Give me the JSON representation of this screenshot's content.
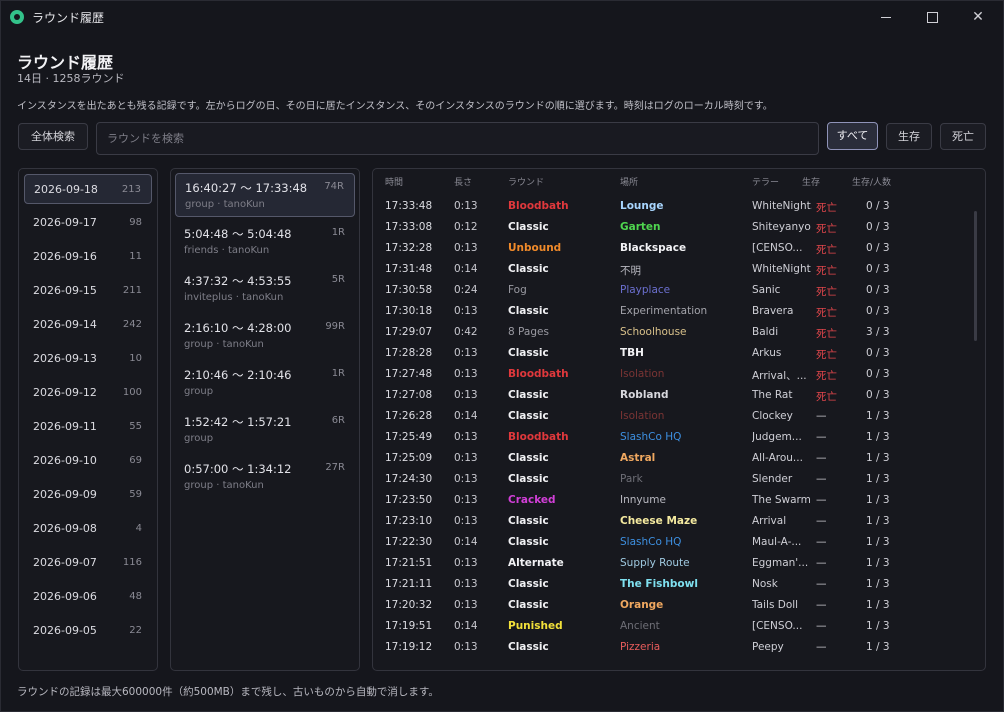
{
  "window": {
    "title": "ラウンド履歴"
  },
  "header": {
    "title": "ラウンド履歴",
    "subtitle": "14日 · 1258ラウンド",
    "description": "インスタンスを出たあとも残る記録です。左からログの日、その日に居たインスタンス、そのインスタンスのラウンドの順に選びます。時刻はログのローカル時刻です。"
  },
  "toolbar": {
    "all_search_label": "全体検索",
    "search_placeholder": "ラウンドを検索",
    "filter_all": "すべて",
    "filter_alive": "生存",
    "filter_dead": "死亡",
    "selected_filter": "すべて"
  },
  "dates": [
    {
      "date": "2026-09-18",
      "count": "213",
      "selected": true
    },
    {
      "date": "2026-09-17",
      "count": "98"
    },
    {
      "date": "2026-09-16",
      "count": "11"
    },
    {
      "date": "2026-09-15",
      "count": "211"
    },
    {
      "date": "2026-09-14",
      "count": "242"
    },
    {
      "date": "2026-09-13",
      "count": "10"
    },
    {
      "date": "2026-09-12",
      "count": "100"
    },
    {
      "date": "2026-09-11",
      "count": "55"
    },
    {
      "date": "2026-09-10",
      "count": "69"
    },
    {
      "date": "2026-09-09",
      "count": "59"
    },
    {
      "date": "2026-09-08",
      "count": "4"
    },
    {
      "date": "2026-09-07",
      "count": "116"
    },
    {
      "date": "2026-09-06",
      "count": "48"
    },
    {
      "date": "2026-09-05",
      "count": "22"
    }
  ],
  "instances": [
    {
      "time": "16:40:27 〜 17:33:48",
      "rounds": "74R",
      "meta": "group · tanoKun",
      "selected": true
    },
    {
      "time": "5:04:48 〜 5:04:48",
      "rounds": "1R",
      "meta": "friends · tanoKun"
    },
    {
      "time": "4:37:32 〜 4:53:55",
      "rounds": "5R",
      "meta": "inviteplus · tanoKun"
    },
    {
      "time": "2:16:10 〜 4:28:00",
      "rounds": "99R",
      "meta": "group · tanoKun"
    },
    {
      "time": "2:10:46 〜 2:10:46",
      "rounds": "1R",
      "meta": "group"
    },
    {
      "time": "1:52:42 〜 1:57:21",
      "rounds": "6R",
      "meta": "group"
    },
    {
      "time": "0:57:00 〜 1:34:12",
      "rounds": "27R",
      "meta": "group · tanoKun"
    }
  ],
  "table": {
    "headers": {
      "time": "時間",
      "length": "長さ",
      "round": "ラウンド",
      "place": "場所",
      "terror": "テラー",
      "status": "生存",
      "ratio": "生存/人数"
    },
    "rows": [
      {
        "time": "17:33:48",
        "length": "0:13",
        "round": "Bloodbath",
        "round_color": "#e0383c",
        "place": "Lounge",
        "place_color": "#a9d6ff",
        "place_bold": true,
        "terror": "WhiteNight...",
        "status": "死亡",
        "dead": true,
        "ratio": "0 / 3"
      },
      {
        "time": "17:33:08",
        "length": "0:12",
        "round": "Classic",
        "round_color": "#f2f2f5",
        "place": "Garten",
        "place_color": "#4fd64f",
        "place_bold": true,
        "terror": "Shiteyanyo",
        "status": "死亡",
        "dead": true,
        "ratio": "0 / 3"
      },
      {
        "time": "17:32:28",
        "length": "0:13",
        "round": "Unbound",
        "round_color": "#f08a2a",
        "place": "Blackspace",
        "place_color": "#f2f2f5",
        "place_bold": true,
        "terror": "[CENSO...",
        "status": "死亡",
        "dead": true,
        "ratio": "0 / 3"
      },
      {
        "time": "17:31:48",
        "length": "0:14",
        "round": "Classic",
        "round_color": "#f2f2f5",
        "place": "不明",
        "place_color": "#b8b8c0",
        "place_bold": false,
        "terror": "WhiteNight",
        "status": "死亡",
        "dead": true,
        "ratio": "0 / 3"
      },
      {
        "time": "17:30:58",
        "length": "0:24",
        "round": "Fog",
        "round_color": "#9a9aa2",
        "round_bold": false,
        "place": "Playplace",
        "place_color": "#6b6fcf",
        "place_bold": false,
        "terror": "Sanic",
        "status": "死亡",
        "dead": true,
        "ratio": "0 / 3"
      },
      {
        "time": "17:30:18",
        "length": "0:13",
        "round": "Classic",
        "round_color": "#f2f2f5",
        "place": "Experimentation",
        "place_color": "#a3a3aa",
        "place_bold": false,
        "terror": "Bravera",
        "status": "死亡",
        "dead": true,
        "ratio": "0 / 3"
      },
      {
        "time": "17:29:07",
        "length": "0:42",
        "round": "8 Pages",
        "round_color": "#9a9aa2",
        "round_bold": false,
        "place": "Schoolhouse",
        "place_color": "#d8c08a",
        "place_bold": false,
        "terror": "Baldi",
        "status": "死亡",
        "dead": true,
        "ratio": "3 / 3"
      },
      {
        "time": "17:28:28",
        "length": "0:13",
        "round": "Classic",
        "round_color": "#f2f2f5",
        "place": "TBH",
        "place_color": "#f2f2f5",
        "place_bold": true,
        "terror": "Arkus",
        "status": "死亡",
        "dead": true,
        "ratio": "0 / 3"
      },
      {
        "time": "17:27:48",
        "length": "0:13",
        "round": "Bloodbath",
        "round_color": "#e0383c",
        "place": "Isolation",
        "place_color": "#7a3434",
        "place_bold": false,
        "terror": "Arrival、...",
        "status": "死亡",
        "dead": true,
        "ratio": "0 / 3"
      },
      {
        "time": "17:27:08",
        "length": "0:13",
        "round": "Classic",
        "round_color": "#f2f2f5",
        "place": "Robland",
        "place_color": "#d8d8de",
        "place_bold": true,
        "terror": "The Rat",
        "status": "死亡",
        "dead": true,
        "ratio": "0 / 3"
      },
      {
        "time": "17:26:28",
        "length": "0:14",
        "round": "Classic",
        "round_color": "#f2f2f5",
        "place": "Isolation",
        "place_color": "#7a3434",
        "place_bold": false,
        "terror": "Clockey",
        "status": "—",
        "dead": false,
        "ratio": "1 / 3"
      },
      {
        "time": "17:25:49",
        "length": "0:13",
        "round": "Bloodbath",
        "round_color": "#e0383c",
        "place": "SlashCo HQ",
        "place_color": "#3d8fe0",
        "place_bold": false,
        "terror": "Judgem...",
        "status": "—",
        "dead": false,
        "ratio": "1 / 3"
      },
      {
        "time": "17:25:09",
        "length": "0:13",
        "round": "Classic",
        "round_color": "#f2f2f5",
        "place": "Astral",
        "place_color": "#f0a860",
        "place_bold": true,
        "terror": "All-Arou...",
        "status": "—",
        "dead": false,
        "ratio": "1 / 3"
      },
      {
        "time": "17:24:30",
        "length": "0:13",
        "round": "Classic",
        "round_color": "#f2f2f5",
        "place": "Park",
        "place_color": "#6e6e76",
        "place_bold": false,
        "terror": "Slender",
        "status": "—",
        "dead": false,
        "ratio": "1 / 3"
      },
      {
        "time": "17:23:50",
        "length": "0:13",
        "round": "Cracked",
        "round_color": "#d23fd8",
        "place": "Innyume",
        "place_color": "#b8b8c0",
        "place_bold": false,
        "terror": "The Swarm",
        "status": "—",
        "dead": false,
        "ratio": "1 / 3"
      },
      {
        "time": "17:23:10",
        "length": "0:13",
        "round": "Classic",
        "round_color": "#f2f2f5",
        "place": "Cheese Maze",
        "place_color": "#f5eaa0",
        "place_bold": true,
        "terror": "Arrival",
        "status": "—",
        "dead": false,
        "ratio": "1 / 3"
      },
      {
        "time": "17:22:30",
        "length": "0:14",
        "round": "Classic",
        "round_color": "#f2f2f5",
        "place": "SlashCo HQ",
        "place_color": "#3d8fe0",
        "place_bold": false,
        "terror": "Maul-A-...",
        "status": "—",
        "dead": false,
        "ratio": "1 / 3"
      },
      {
        "time": "17:21:51",
        "length": "0:13",
        "round": "Alternate",
        "round_color": "#f2f2f5",
        "place": "Supply Route",
        "place_color": "#9fc9e0",
        "place_bold": false,
        "terror": "Eggman'...",
        "status": "—",
        "dead": false,
        "ratio": "1 / 3"
      },
      {
        "time": "17:21:11",
        "length": "0:13",
        "round": "Classic",
        "round_color": "#f2f2f5",
        "place": "The Fishbowl",
        "place_color": "#7fe0f0",
        "place_bold": true,
        "terror": "Nosk",
        "status": "—",
        "dead": false,
        "ratio": "1 / 3"
      },
      {
        "time": "17:20:32",
        "length": "0:13",
        "round": "Classic",
        "round_color": "#f2f2f5",
        "place": "Orange",
        "place_color": "#f0a860",
        "place_bold": true,
        "terror": "Tails Doll",
        "status": "—",
        "dead": false,
        "ratio": "1 / 3"
      },
      {
        "time": "17:19:51",
        "length": "0:14",
        "round": "Punished",
        "round_color": "#f2e03a",
        "place": "Ancient",
        "place_color": "#6e6e76",
        "place_bold": false,
        "terror": "[CENSO...",
        "status": "—",
        "dead": false,
        "ratio": "1 / 3"
      },
      {
        "time": "17:19:12",
        "length": "0:13",
        "round": "Classic",
        "round_color": "#f2f2f5",
        "place": "Pizzeria",
        "place_color": "#e85c5c",
        "place_bold": false,
        "terror": "Peepy",
        "status": "—",
        "dead": false,
        "ratio": "1 / 3"
      }
    ]
  },
  "footer": {
    "text": "ラウンドの記録は最大600000件（約500MB）まで残し、古いものから自動で消します。"
  }
}
